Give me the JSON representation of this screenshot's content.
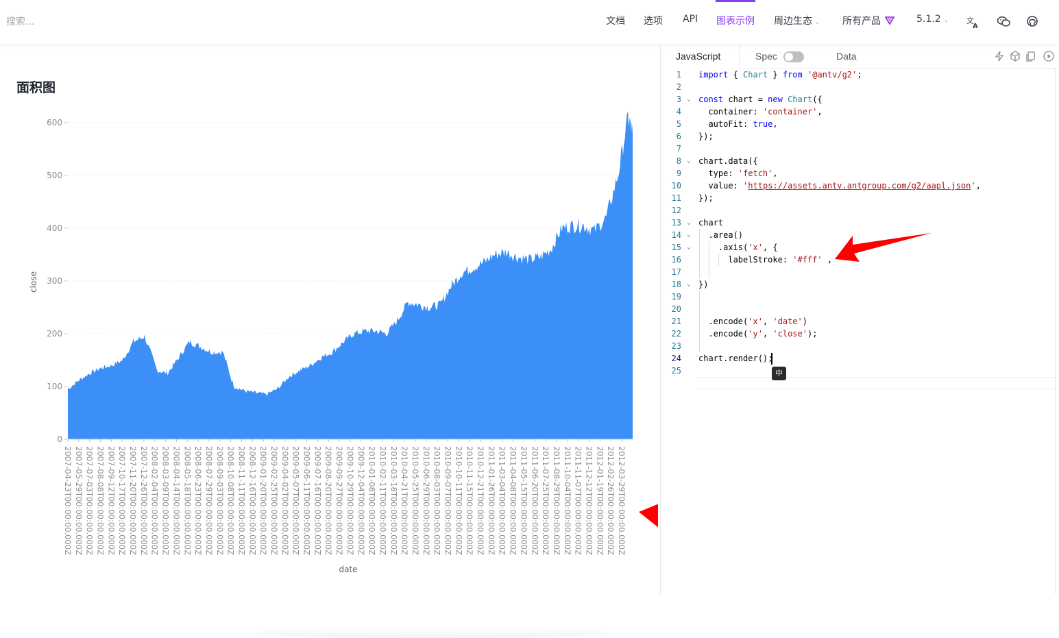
{
  "header": {
    "search_placeholder": "搜索...",
    "nav": [
      {
        "label": "文档"
      },
      {
        "label": "选项"
      },
      {
        "label": "API"
      },
      {
        "label": "图表示例",
        "active": true
      },
      {
        "label": "周边生态",
        "dropdown": true
      },
      {
        "label": "所有产品",
        "dropdown": false
      }
    ],
    "version": "5.1.2",
    "icons": [
      "translate-icon",
      "wechat-icon",
      "github-icon",
      "product-logo-icon"
    ]
  },
  "page": {
    "title": "面积图"
  },
  "chart_data": {
    "type": "area",
    "xlabel": "date",
    "ylabel": "close",
    "ylim": [
      0,
      640
    ],
    "yticks": [
      0,
      100,
      200,
      300,
      400,
      500,
      600
    ],
    "color": "#3b8ff6",
    "x_tick_labels": [
      "2007-04-23T00:00:00.000Z",
      "2007-05-29T00:00:00.000Z",
      "2007-07-03T00:00:00.000Z",
      "2007-08-08T00:00:00.000Z",
      "2007-09-12T00:00:00.000Z",
      "2007-10-17T00:00:00.000Z",
      "2007-11-20T00:00:00.000Z",
      "2007-12-26T00:00:00.000Z",
      "2008-02-04T00:00:00.000Z",
      "2008-03-09T00:00:00.000Z",
      "2008-04-14T00:00:00.000Z",
      "2008-05-18T00:00:00.000Z",
      "2008-06-23T00:00:00.000Z",
      "2008-07-29T00:00:00.000Z",
      "2008-09-03T00:00:00.000Z",
      "2008-10-08T00:00:00.000Z",
      "2008-11-11T00:00:00.000Z",
      "2008-12-16T00:00:00.000Z",
      "2009-01-20T00:00:00.000Z",
      "2009-02-25T00:00:00.000Z",
      "2009-04-02T00:00:00.000Z",
      "2009-05-07T00:00:00.000Z",
      "2009-06-11T00:00:00.000Z",
      "2009-07-16T00:00:00.000Z",
      "2009-08-20T00:00:00.000Z",
      "2009-09-27T00:00:00.000Z",
      "2009-10-29T00:00:00.000Z",
      "2009-12-04T00:00:00.000Z",
      "2010-01-08T00:00:00.000Z",
      "2010-02-11T00:00:00.000Z",
      "2010-03-18T00:00:00.000Z",
      "2010-04-21T00:00:00.000Z",
      "2010-05-25T00:00:00.000Z",
      "2010-06-29T00:00:00.000Z",
      "2010-08-03T00:00:00.000Z",
      "2010-09-07T00:00:00.000Z",
      "2010-10-11T00:00:00.000Z",
      "2010-11-15T00:00:00.000Z",
      "2010-12-21T00:00:00.000Z",
      "2011-01-26T00:00:00.000Z",
      "2011-03-04T00:00:00.000Z",
      "2011-04-08T00:00:00.000Z",
      "2011-05-15T00:00:00.000Z",
      "2011-06-20T00:00:00.000Z",
      "2011-07-25T00:00:00.000Z",
      "2011-08-29T00:00:00.000Z",
      "2011-10-04T00:00:00.000Z",
      "2011-11-07T00:00:00.000Z",
      "2011-12-12T00:00:00.000Z",
      "2012-01-19T00:00:00.000Z",
      "2012-02-26T00:00:00.000Z",
      "2012-03-29T00:00:00.000Z"
    ],
    "series": [
      {
        "x": [
          "2007-04-23",
          "2007-05-29",
          "2007-07-03",
          "2007-08-08",
          "2007-09-12",
          "2007-10-17",
          "2007-11-20",
          "2007-12-26",
          "2008-02-04",
          "2008-03-09",
          "2008-04-14",
          "2008-05-18",
          "2008-06-23",
          "2008-07-29",
          "2008-09-03",
          "2008-10-08",
          "2008-11-11",
          "2008-12-16",
          "2009-01-20",
          "2009-02-25",
          "2009-04-02",
          "2009-05-07",
          "2009-06-11",
          "2009-07-16",
          "2009-08-20",
          "2009-09-27",
          "2009-10-29",
          "2009-12-04",
          "2010-01-08",
          "2010-02-11",
          "2010-03-18",
          "2010-04-21",
          "2010-05-25",
          "2010-06-29",
          "2010-08-03",
          "2010-09-07",
          "2010-10-11",
          "2010-11-15",
          "2010-12-21",
          "2011-01-26",
          "2011-03-04",
          "2011-04-08",
          "2011-05-15",
          "2011-06-20",
          "2011-07-25",
          "2011-08-29",
          "2011-10-04",
          "2011-11-07",
          "2011-12-12",
          "2012-01-19",
          "2012-02-26",
          "2012-03-29",
          "2012-04-13"
        ],
        "values": [
          95,
          112,
          125,
          135,
          140,
          150,
          185,
          195,
          130,
          125,
          155,
          185,
          175,
          165,
          165,
          100,
          92,
          88,
          85,
          95,
          118,
          130,
          140,
          155,
          165,
          185,
          200,
          205,
          205,
          200,
          225,
          260,
          255,
          250,
          255,
          290,
          315,
          325,
          335,
          350,
          355,
          345,
          340,
          345,
          360,
          400,
          405,
          405,
          395,
          420,
          500,
          610,
          580
        ]
      }
    ]
  },
  "editor": {
    "tabs": {
      "javascript": "JavaScript",
      "spec": "Spec",
      "data": "Data"
    },
    "code": {
      "l1_import": "import",
      "l1_brace_open": " { ",
      "l1_chart": "Chart",
      "l1_brace_close": " } ",
      "l1_from": "from",
      "l1_space": " ",
      "l1_module": "'@antv/g2'",
      "l1_semi": ";",
      "l3_const": "const",
      "l3_chartvar": " chart = ",
      "l3_new": "new",
      "l3_space": " ",
      "l3_Chart": "Chart",
      "l3_paren": "({",
      "l4_key": "  container: ",
      "l4_val": "'container'",
      "l4_comma": ",",
      "l5_key": "  autoFit: ",
      "l5_val": "true",
      "l5_comma": ",",
      "l6": "});",
      "l8": "chart.data({",
      "l9_key": "  type: ",
      "l9_val": "'fetch'",
      "l9_comma": ",",
      "l10_key": "  value: ",
      "l10_q1": "'",
      "l10_url": "https://assets.antv.antgroup.com/g2/aapl.json",
      "l10_q2": "'",
      "l10_comma": ",",
      "l11": "});",
      "l13": "chart",
      "l14": "  .area()",
      "l15_a": "    .axis(",
      "l15_x": "'x'",
      "l15_b": ", {",
      "l16_key": "      labelStroke: ",
      "l16_val": "'#fff'",
      "l16_tail": " ,",
      "l18": "})",
      "l21_a": "  .encode(",
      "l21_x": "'x'",
      "l21_sep": ", ",
      "l21_date": "'date'",
      "l21_close": ")",
      "l22_a": "  .encode(",
      "l22_y": "'y'",
      "l22_sep": ", ",
      "l22_close_s": "'close'",
      "l22_end": ");",
      "l24": "chart.render();"
    },
    "ime_indicator": "中"
  }
}
